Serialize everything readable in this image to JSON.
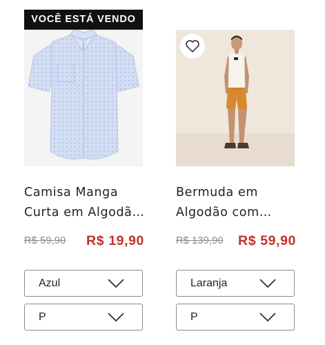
{
  "badge": {
    "label": "VOCÊ ESTÁ VENDO"
  },
  "products": [
    {
      "title_line1": "Camisa Manga",
      "title_line2": "Curta em Algodã…",
      "old_price": "R$ 59,90",
      "new_price": "R$ 19,90",
      "color_value": "Azul",
      "size_value": "P"
    },
    {
      "title_line1": "Bermuda em",
      "title_line2": "Algodão com…",
      "old_price": "R$ 139,90",
      "new_price": "R$ 59,90",
      "color_value": "Laranja",
      "size_value": "P"
    }
  ],
  "icons": {
    "favorite": "heart-outline-icon",
    "dropdown": "chevron-down-icon"
  },
  "colors": {
    "price_red": "#c0322d",
    "badge_bg": "#111111",
    "shirt": "#c9d6f0",
    "shorts": "#d8892e"
  }
}
